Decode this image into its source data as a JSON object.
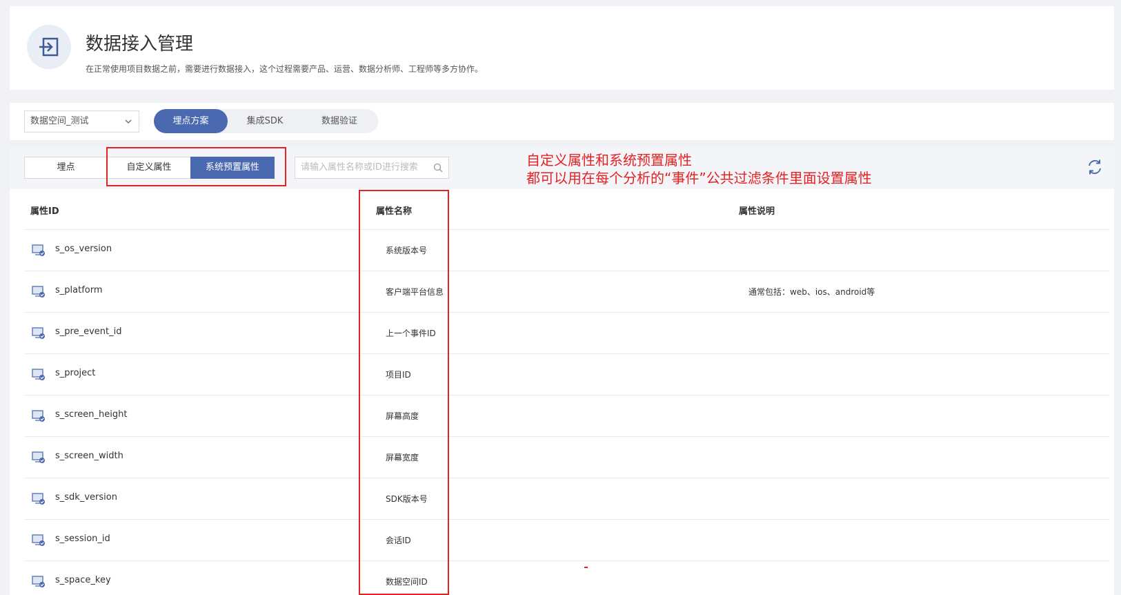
{
  "header": {
    "title": "数据接入管理",
    "subtitle": "在正常使用项目数据之前，需要进行数据接入，这个过程需要产品、运营、数据分析师、工程师等多方协作。"
  },
  "toolbar": {
    "space_select": "数据空间_测试",
    "steps": [
      {
        "label": "埋点方案",
        "active": true
      },
      {
        "label": "集成SDK",
        "active": false
      },
      {
        "label": "数据验证",
        "active": false
      }
    ]
  },
  "filters": {
    "segments": [
      {
        "label": "埋点",
        "active": false
      },
      {
        "label": "自定义属性",
        "active": false
      },
      {
        "label": "系统预置属性",
        "active": true
      }
    ],
    "search_placeholder": "请输入属性名称或ID进行搜索"
  },
  "annotation": {
    "text": "自定义属性和系统预置属性\n都可以用在每个分析的“事件”公共过滤条件里面设置属性"
  },
  "table": {
    "headers": [
      "属性ID",
      "属性名称",
      "属性说明"
    ],
    "rows": [
      {
        "id": "s_os_version",
        "name": "系统版本号",
        "desc": ""
      },
      {
        "id": "s_platform",
        "name": "客户端平台信息",
        "desc": "通常包括：web、ios、android等"
      },
      {
        "id": "s_pre_event_id",
        "name": "上一个事件ID",
        "desc": ""
      },
      {
        "id": "s_project",
        "name": "项目ID",
        "desc": ""
      },
      {
        "id": "s_screen_height",
        "name": "屏幕高度",
        "desc": ""
      },
      {
        "id": "s_screen_width",
        "name": "屏幕宽度",
        "desc": ""
      },
      {
        "id": "s_sdk_version",
        "name": "SDK版本号",
        "desc": ""
      },
      {
        "id": "s_session_id",
        "name": "会话ID",
        "desc": ""
      },
      {
        "id": "s_space_key",
        "name": "数据空间ID",
        "desc": ""
      }
    ]
  },
  "colors": {
    "accent": "#4a69b0",
    "annotation_red": "#e52222"
  }
}
